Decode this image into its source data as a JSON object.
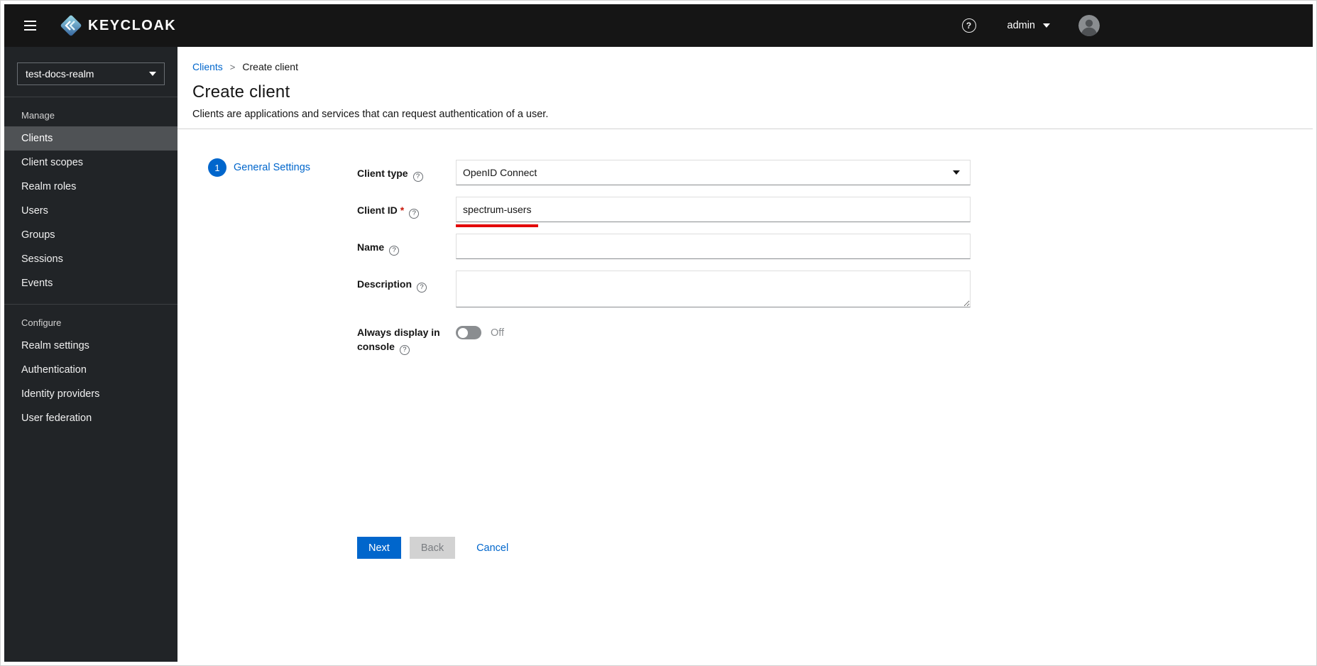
{
  "colors": {
    "accent": "#0066cc",
    "masthead_bg": "#151515",
    "sidebar_bg": "#212427",
    "active_item_bg": "#4f5255",
    "annotation": "#e30000",
    "required": "#c9190b"
  },
  "icons": {
    "help": "?"
  },
  "header": {
    "brand": "KEYCLOAK",
    "user_label": "admin"
  },
  "sidebar": {
    "realm_selector": "test-docs-realm",
    "sections": [
      {
        "label": "Manage",
        "items": [
          {
            "label": "Clients",
            "active": true
          },
          {
            "label": "Client scopes",
            "active": false
          },
          {
            "label": "Realm roles",
            "active": false
          },
          {
            "label": "Users",
            "active": false
          },
          {
            "label": "Groups",
            "active": false
          },
          {
            "label": "Sessions",
            "active": false
          },
          {
            "label": "Events",
            "active": false
          }
        ]
      },
      {
        "label": "Configure",
        "items": [
          {
            "label": "Realm settings",
            "active": false
          },
          {
            "label": "Authentication",
            "active": false
          },
          {
            "label": "Identity providers",
            "active": false
          },
          {
            "label": "User federation",
            "active": false
          }
        ]
      }
    ]
  },
  "breadcrumb": {
    "parent": "Clients",
    "separator": ">",
    "current": "Create client"
  },
  "page": {
    "title": "Create client",
    "subtitle": "Clients are applications and services that can request authentication of a user."
  },
  "wizard": {
    "step_number": "1",
    "step_label": "General Settings"
  },
  "form": {
    "client_type": {
      "label": "Client type",
      "value": "OpenID Connect"
    },
    "client_id": {
      "label": "Client ID",
      "required": "*",
      "value": "spectrum-users"
    },
    "name": {
      "label": "Name",
      "value": ""
    },
    "description": {
      "label": "Description",
      "value": ""
    },
    "always_display": {
      "label": "Always display in console",
      "state": "Off"
    }
  },
  "actions": {
    "next": "Next",
    "back": "Back",
    "cancel": "Cancel"
  }
}
